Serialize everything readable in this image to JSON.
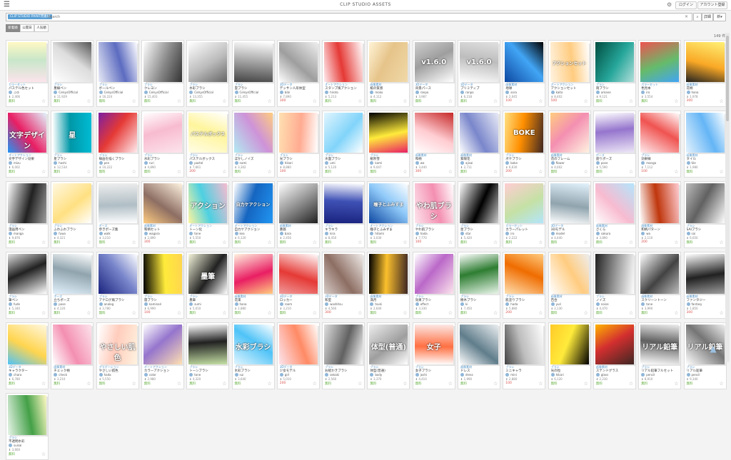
{
  "header": {
    "menu_icon": "hamburger-icon",
    "title": "CLIP STUDIO ASSETS",
    "login_label": "ログイン",
    "register_label": "アカウント登録"
  },
  "search": {
    "chip": "CLIP STUDIO PAINT用素材",
    "placeholder": "Search",
    "clear": "✕",
    "search_label": "検索",
    "detail_label": "詳細",
    "sort_label": "新"
  },
  "tabs": [
    "新着順",
    "公開日",
    "人気順"
  ],
  "result_count": "149 件",
  "colors": {
    "accent": "#5a9fd4",
    "free": "#5fae3a",
    "paid": "#d9534f"
  },
  "cards": [
    {
      "cat": "カラーセット",
      "title": "パステル色セット",
      "author": "ふゆ",
      "dl": "2,406",
      "price": "無料",
      "thumb": [
        "#fce4ec",
        "#c8e6c9",
        "#fff9c4"
      ],
      "ov": ""
    },
    {
      "cat": "ブラシ",
      "title": "墨線ペン",
      "author": "CelsysOfficial",
      "dl": "11,929",
      "price": "無料",
      "thumb": [
        "#ffffff",
        "#dddddd",
        "#555555"
      ],
      "ov": ""
    },
    {
      "cat": "ブラシ",
      "title": "ボールペン",
      "author": "CelsysOfficial",
      "dl": "16,224",
      "price": "無料",
      "thumb": [
        "#e8eaf6",
        "#5c6bc0",
        "#ffffff"
      ],
      "ov": ""
    },
    {
      "cat": "ブラシ",
      "title": "クレヨン",
      "author": "CelsysOfficial",
      "dl": "15,403",
      "price": "無料",
      "thumb": [
        "#ffffff",
        "#888888",
        "#333333"
      ],
      "ov": ""
    },
    {
      "cat": "ブラシ",
      "title": "水彩ブラシ",
      "author": "CelsysOfficial",
      "dl": "13,355",
      "price": "無料",
      "thumb": [
        "#ffffff",
        "#bbbbbb",
        "#666666"
      ],
      "ov": ""
    },
    {
      "cat": "ブラシ",
      "title": "雲ブラシ",
      "author": "CelsysOfficial",
      "dl": "11,455",
      "price": "無料",
      "thumb": [
        "#ffffff",
        "#999999",
        "#444444"
      ],
      "ov": ""
    },
    {
      "cat": "3Dデータ",
      "title": "デッサン人形体型",
      "author": "bibi",
      "dl": "7,890",
      "price": "300",
      "thumb": [
        "#eeeeee",
        "#9e9e9e",
        "#ffffff"
      ],
      "ov": ""
    },
    {
      "cat": "オートアクション",
      "title": "スタンプ風アクション",
      "author": "hiroto",
      "dl": "5,213",
      "price": "無料",
      "thumb": [
        "#ffffff",
        "#e53935",
        "#ffebee"
      ],
      "ov": ""
    },
    {
      "cat": "画像素材",
      "title": "紙の質感",
      "author": "moko",
      "dl": "4,112",
      "price": "無料",
      "thumb": [
        "#f0d9a8",
        "#e6c48a",
        "#fff3d6"
      ],
      "ov": ""
    },
    {
      "cat": "3Dデータ",
      "title": "背景パース",
      "author": "ranpo",
      "dl": "3,987",
      "price": "無料",
      "thumb": [
        "#ffffff",
        "#9e9e9e",
        "#cfcfcf"
      ],
      "ov": "v1.6.0"
    },
    {
      "cat": "3Dデータ",
      "title": "プリミティブ",
      "author": "ranpo",
      "dl": "6,218",
      "price": "無料",
      "thumb": [
        "#ffffff",
        "#bdbdbd",
        "#e0e0e0"
      ],
      "ov": "v1.6.0"
    },
    {
      "cat": "画像素材",
      "title": "地球",
      "author": "sora",
      "dl": "2,045",
      "price": "100",
      "thumb": [
        "#0d47a1",
        "#42a5f5",
        "#000000"
      ],
      "ov": ""
    },
    {
      "cat": "オートアクション",
      "title": "アクションセット",
      "author": "kaito",
      "dl": "8,402",
      "price": "500",
      "thumb": [
        "#fff3e0",
        "#ffcc80",
        "#ffffff"
      ],
      "ov": "アクションセット"
    },
    {
      "cat": "ブラシ",
      "title": "雨ブラシ",
      "author": "amane",
      "dl": "9,121",
      "price": "無料",
      "thumb": [
        "#004d40",
        "#26a69a",
        "#b2dfdb"
      ],
      "ov": ""
    },
    {
      "cat": "カラーセット",
      "title": "色見本",
      "author": "iro",
      "dl": "3,554",
      "price": "無料",
      "thumb": [
        "#ef5350",
        "#66bb6a",
        "#42a5f5"
      ],
      "ov": ""
    },
    {
      "cat": "画像素材",
      "title": "花柄",
      "author": "hana",
      "dl": "1,978",
      "price": "300",
      "thumb": [
        "#fff176",
        "#f9a825",
        "#212121"
      ],
      "ov": ""
    },
    {
      "cat": "オートアクション",
      "title": "文字デザイン効果",
      "author": "mizu",
      "dl": "6,002",
      "price": "無料",
      "thumb": [
        "#e1f5fe",
        "#e91e63",
        "#2196f3"
      ],
      "ov": "文字デザイン"
    },
    {
      "cat": "ブラシ",
      "title": "星ブラシ",
      "author": "hoshi",
      "dl": "12,534",
      "price": "無料",
      "thumb": [
        "#00bcd4",
        "#0097a7",
        "#ffffff"
      ],
      "ov": "星"
    },
    {
      "cat": "ブラシ",
      "title": "線画を描くブラシ",
      "author": "pen",
      "dl": "10,222",
      "price": "無料",
      "thumb": [
        "#ffebee",
        "#e53935",
        "#7b1fa2"
      ],
      "ov": ""
    },
    {
      "cat": "ブラシ",
      "title": "水彩ブラシ",
      "author": "ruri",
      "dl": "4,890",
      "price": "無料",
      "thumb": [
        "#fce4ec",
        "#f8bbd0",
        "#ffffff"
      ],
      "ov": ""
    },
    {
      "cat": "ブラシ",
      "title": "パステルボックス",
      "author": "pastel",
      "dl": "7,661",
      "price": "200",
      "thumb": [
        "#fffde7",
        "#fff59d",
        "#ffffff"
      ],
      "ov": "パステルボックス"
    },
    {
      "cat": "ブラシ",
      "title": "ぼかしノイズ",
      "author": "nami",
      "dl": "3,302",
      "price": "無料",
      "thumb": [
        "#b2ebf2",
        "#ce93d8",
        "#ffcc80"
      ],
      "ov": ""
    },
    {
      "cat": "ブラシ",
      "title": "光ブラシ",
      "author": "hikari",
      "dl": "8,880",
      "price": "100",
      "thumb": [
        "#ffe0b2",
        "#ffab91",
        "#fff"
      ],
      "ov": ""
    },
    {
      "cat": "ブラシ",
      "title": "水面ブラシ",
      "author": "umi",
      "dl": "5,120",
      "price": "無料",
      "thumb": [
        "#e1f5fe",
        "#81d4fa",
        "#ffffff"
      ],
      "ov": ""
    },
    {
      "cat": "ブラシ",
      "title": "紙吹雪",
      "author": "kami",
      "dl": "9,047",
      "price": "無料",
      "thumb": [
        "#000000",
        "#ffeb3b",
        "#e91e63"
      ],
      "ov": ""
    },
    {
      "cat": "画像素材",
      "title": "和柄",
      "author": "wa",
      "dl": "3,440",
      "price": "300",
      "thumb": [
        "#c62828",
        "#ffcdd2",
        "#ffffff"
      ],
      "ov": ""
    },
    {
      "cat": "画像素材",
      "title": "紫陽花",
      "author": "ajisai",
      "dl": "2,711",
      "price": "無料",
      "thumb": [
        "#e8eaf6",
        "#7986cb",
        "#ffffff"
      ],
      "ov": ""
    },
    {
      "cat": "ブラシ",
      "title": "ボケブラシ",
      "author": "boke",
      "dl": "6,630",
      "price": "200",
      "thumb": [
        "#3e2723",
        "#ff8f00",
        "#ffe082"
      ],
      "ov": "BOKE"
    },
    {
      "cat": "画像素材",
      "title": "花のフレーム",
      "author": "flower",
      "dl": "4,002",
      "price": "無料",
      "thumb": [
        "#fff3e0",
        "#f48fb1",
        "#ffcc80"
      ],
      "ov": ""
    },
    {
      "cat": "ポーズ",
      "title": "座りポーズ",
      "author": "pose",
      "dl": "5,590",
      "price": "無料",
      "thumb": [
        "#ede7f6",
        "#9575cd",
        "#ffffff"
      ],
      "ov": ""
    },
    {
      "cat": "ブラシ",
      "title": "効果線",
      "author": "manga",
      "dl": "7,112",
      "price": "100",
      "thumb": [
        "#ffebee",
        "#ef5350",
        "#ffffff"
      ],
      "ov": ""
    },
    {
      "cat": "画像素材",
      "title": "タイル",
      "author": "tile",
      "dl": "1,980",
      "price": "無料",
      "thumb": [
        "#e3f2fd",
        "#64b5f6",
        "#ffffff"
      ],
      "ov": ""
    },
    {
      "cat": "ブラシ",
      "title": "漫画用ペン",
      "author": "manga",
      "dl": "9,876",
      "price": "無料",
      "thumb": [
        "#ffffff",
        "#212121",
        "#9e9e9e"
      ],
      "ov": ""
    },
    {
      "cat": "ブラシ",
      "title": "ふわふわブラシ",
      "author": "fuwa",
      "dl": "4,321",
      "price": "無料",
      "thumb": [
        "#fff8e1",
        "#ffe082",
        "#ffffff"
      ],
      "ov": ""
    },
    {
      "cat": "ポーズ",
      "title": "歩きポーズ集",
      "author": "walk",
      "dl": "3,210",
      "price": "無料",
      "thumb": [
        "#eeeeee",
        "#b0bec5",
        "#ffffff"
      ],
      "ov": ""
    },
    {
      "cat": "画像素材",
      "title": "和柄セット",
      "author": "wagara",
      "dl": "2,890",
      "price": "300",
      "thumb": [
        "#fff3e0",
        "#8d6e63",
        "#ffcc80"
      ],
      "ov": ""
    },
    {
      "cat": "オートアクション",
      "title": "トーン化",
      "author": "tone",
      "dl": "5,550",
      "price": "無料",
      "thumb": [
        "#f8bbd0",
        "#4dd0e1",
        "#fff59d"
      ],
      "ov": "アクション"
    },
    {
      "cat": "オートアクション",
      "title": "自力ケアクション",
      "author": "kea",
      "dl": "6,120",
      "price": "無料",
      "thumb": [
        "#2196f3",
        "#1565c0",
        "#ffffff"
      ],
      "ov": "自力ケアクション"
    },
    {
      "cat": "画像素材",
      "title": "薔薇",
      "author": "bara",
      "dl": "2,456",
      "price": "無料",
      "thumb": [
        "#212121",
        "#9e9e9e",
        "#ffffff"
      ],
      "ov": ""
    },
    {
      "cat": "ブラシ",
      "title": "キラキラ",
      "author": "kira",
      "dl": "8,450",
      "price": "無料",
      "thumb": [
        "#1a237e",
        "#3f51b5",
        "#ffffff"
      ],
      "ov": ""
    },
    {
      "cat": "オートアクション",
      "title": "瞳子とふみすま",
      "author": "hitomi",
      "dl": "3,030",
      "price": "無料",
      "thumb": [
        "#0d47a1",
        "#90caf9",
        "#ffffff"
      ],
      "ov": "瞳子とふみすま"
    },
    {
      "cat": "ブラシ",
      "title": "やわ肌ブラシ",
      "author": "hada",
      "dl": "7,770",
      "price": "100",
      "thumb": [
        "#fce4ec",
        "#f48fb1",
        "#ffffff"
      ],
      "ov": "やわ肌ブラシ"
    },
    {
      "cat": "ブラシ",
      "title": "星ブラシ",
      "author": "star",
      "dl": "5,420",
      "price": "無料",
      "thumb": [
        "#ffffff",
        "#000000",
        "#cccccc"
      ],
      "ov": ""
    },
    {
      "cat": "カラーセット",
      "title": "カラーパレット",
      "author": "iro",
      "dl": "2,222",
      "price": "無料",
      "thumb": [
        "#ffcdd2",
        "#c5e1a5",
        "#b3e5fc"
      ],
      "ov": ""
    },
    {
      "cat": "3Dデータ",
      "title": "3Dモデル",
      "author": "model",
      "dl": "4,440",
      "price": "無料",
      "thumb": [
        "#e3f2fd",
        "#90a4ae",
        "#ffffff"
      ],
      "ov": ""
    },
    {
      "cat": "画像素材",
      "title": "さくら",
      "author": "sakura",
      "dl": "3,890",
      "price": "無料",
      "thumb": [
        "#b3e5fc",
        "#f8bbd0",
        "#ffffff"
      ],
      "ov": ""
    },
    {
      "cat": "画像素材",
      "title": "和柄パターン",
      "author": "wa",
      "dl": "2,110",
      "price": "200",
      "thumb": [
        "#ffcdd2",
        "#bf360c",
        "#ffffff"
      ],
      "ov": ""
    },
    {
      "cat": "ブラシ",
      "title": "SAIブラシ",
      "author": "sai",
      "dl": "6,650",
      "price": "無料",
      "thumb": [
        "#ffffff",
        "#616161",
        "#bdbdbd"
      ],
      "ov": ""
    },
    {
      "cat": "ブラシ",
      "title": "筆ペン",
      "author": "fude",
      "dl": "5,340",
      "price": "無料",
      "thumb": [
        "#ffffff",
        "#212121",
        "#e0e0e0"
      ],
      "ov": ""
    },
    {
      "cat": "ポーズ",
      "title": "立ちポーズ",
      "author": "pose",
      "dl": "4,120",
      "price": "無料",
      "thumb": [
        "#e3f2fd",
        "#90a4ae",
        "#ffffff"
      ],
      "ov": ""
    },
    {
      "cat": "ブラシ",
      "title": "アナログ風ブラシ",
      "author": "analog",
      "dl": "3,780",
      "price": "無料",
      "thumb": [
        "#1a237e",
        "#7986cb",
        "#ffffff"
      ],
      "ov": ""
    },
    {
      "cat": "ブラシ",
      "title": "雷ブラシ",
      "author": "kaminari",
      "dl": "6,990",
      "price": "100",
      "thumb": [
        "#000000",
        "#ffeb3b",
        "#ffd54f"
      ],
      "ov": ""
    },
    {
      "cat": "ブラシ",
      "title": "墨筆",
      "author": "sumi",
      "dl": "5,010",
      "price": "無料",
      "thumb": [
        "#f5f5dc",
        "#212121",
        "#ffffff"
      ],
      "ov": "墨筆"
    },
    {
      "cat": "画像素材",
      "title": "花束",
      "author": "hana",
      "dl": "2,880",
      "price": "無料",
      "thumb": [
        "#fff3e0",
        "#e91e63",
        "#ffcc80"
      ],
      "ov": ""
    },
    {
      "cat": "3Dデータ",
      "title": "ロッカー",
      "author": "room",
      "dl": "3,210",
      "price": "無料",
      "thumb": [
        "#ffffff",
        "#e53935",
        "#ef9a9a"
      ],
      "ov": ""
    },
    {
      "cat": "3Dデータ",
      "title": "和室",
      "author": "washitsu",
      "dl": "4,560",
      "price": "300",
      "thumb": [
        "#efebe9",
        "#8d6e63",
        "#d7ccc8"
      ],
      "ov": ""
    },
    {
      "cat": "画像素材",
      "title": "満月",
      "author": "tsuki",
      "dl": "2,640",
      "price": "無料",
      "thumb": [
        "#3e2723",
        "#fbc02d",
        "#000000"
      ],
      "ov": ""
    },
    {
      "cat": "ブラシ",
      "title": "効果ブラシ",
      "author": "effect",
      "dl": "3,330",
      "price": "無料",
      "thumb": [
        "#fce4ec",
        "#ba68c8",
        "#ffffff"
      ],
      "ov": ""
    },
    {
      "cat": "ブラシ",
      "title": "樹木ブラシ",
      "author": "ki",
      "dl": "7,450",
      "price": "無料",
      "thumb": [
        "#e8f5e9",
        "#2e7d32",
        "#ffffff"
      ],
      "ov": ""
    },
    {
      "cat": "ブラシ",
      "title": "肌塗りブラシ",
      "author": "hada",
      "dl": "5,880",
      "price": "200",
      "thumb": [
        "#ffe0b2",
        "#ef6c00",
        "#ffcc80"
      ],
      "ov": ""
    },
    {
      "cat": "画像素材",
      "title": "百合",
      "author": "yuri",
      "dl": "2,130",
      "price": "無料",
      "thumb": [
        "#ffffff",
        "#ffcc80",
        "#eeeeee"
      ],
      "ov": ""
    },
    {
      "cat": "ブラシ",
      "title": "ノイズ",
      "author": "noise",
      "dl": "4,470",
      "price": "無料",
      "thumb": [
        "#212121",
        "#9e9e9e",
        "#ffffff"
      ],
      "ov": ""
    },
    {
      "cat": "画像素材",
      "title": "スクリーントーン",
      "author": "tone",
      "dl": "3,990",
      "price": "無料",
      "thumb": [
        "#ffffff",
        "#424242",
        "#bdbdbd"
      ],
      "ov": ""
    },
    {
      "cat": "画像素材",
      "title": "ファンタジー",
      "author": "fantasy",
      "dl": "1,850",
      "price": "300",
      "thumb": [
        "#ffffff",
        "#212121",
        "#9e9e9e"
      ],
      "ov": ""
    },
    {
      "cat": "3Dデータ",
      "title": "キャラクター",
      "author": "chara",
      "dl": "6,780",
      "price": "無料",
      "thumb": [
        "#fff8e1",
        "#ffd54f",
        "#4fc3f7"
      ],
      "ov": ""
    },
    {
      "cat": "画像素材",
      "title": "チェック柄",
      "author": "check",
      "dl": "3,210",
      "price": "無料",
      "thumb": [
        "#fce4ec",
        "#f48fb1",
        "#ffffff"
      ],
      "ov": ""
    },
    {
      "cat": "グラデーション",
      "title": "やさしい肌色",
      "author": "hada",
      "dl": "5,550",
      "price": "無料",
      "thumb": [
        "#fff3e0",
        "#ffccbc",
        "#ffffff"
      ],
      "ov": "やさしい肌色"
    },
    {
      "cat": "オートアクション",
      "title": "カラーアクション",
      "author": "color",
      "dl": "2,980",
      "price": "無料",
      "thumb": [
        "#ffe0b2",
        "#9575cd",
        "#ffffff"
      ],
      "ov": ""
    },
    {
      "cat": "ブラシ",
      "title": "トーンブラシ",
      "author": "tone",
      "dl": "4,320",
      "price": "無料",
      "thumb": [
        "#c5e1a5",
        "#212121",
        "#ffffff"
      ],
      "ov": ""
    },
    {
      "cat": "ブラシ",
      "title": "水彩ブラシ",
      "author": "sui",
      "dl": "3,640",
      "price": "無料",
      "thumb": [
        "#e1f5fe",
        "#4fc3f7",
        "#ffffff"
      ],
      "ov": "水彩ブラシ"
    },
    {
      "cat": "3Dデータ",
      "title": "少女モデル",
      "author": "girl",
      "dl": "5,010",
      "price": "200",
      "thumb": [
        "#fce4ec",
        "#ff8a65",
        "#ffffff"
      ],
      "ov": ""
    },
    {
      "cat": "ブラシ",
      "title": "お絵かきブラシ",
      "author": "oekaki",
      "dl": "2,560",
      "price": "無料",
      "thumb": [
        "#e0e0e0",
        "#616161",
        "#ffffff"
      ],
      "ov": ""
    },
    {
      "cat": "ブラシ",
      "title": "体型(普通)",
      "author": "body",
      "dl": "3,370",
      "price": "無料",
      "thumb": [
        "#eeeeee",
        "#9e9e9e",
        "#ffffff"
      ],
      "ov": "体型(普通)"
    },
    {
      "cat": "ブラシ",
      "title": "女子ブラシ",
      "author": "joshi",
      "dl": "4,410",
      "price": "無料",
      "thumb": [
        "#fbe9e7",
        "#ff7043",
        "#ffffff"
      ],
      "ov": "女子"
    },
    {
      "cat": "画像素材",
      "title": "ドレス",
      "author": "dress",
      "dl": "1,990",
      "price": "無料",
      "thumb": [
        "#eceff1",
        "#607d8b",
        "#ffffff"
      ],
      "ov": ""
    },
    {
      "cat": "ブラシ",
      "title": "ミニキャラ",
      "author": "mini",
      "dl": "2,880",
      "price": "100",
      "thumb": [
        "#ffffff",
        "#bdbdbd",
        "#424242"
      ],
      "ov": ""
    },
    {
      "cat": "ブラシ",
      "title": "光の粒",
      "author": "hikari",
      "dl": "6,120",
      "price": "無料",
      "thumb": [
        "#000000",
        "#ffeb3b",
        "#ffca28"
      ],
      "ov": ""
    },
    {
      "cat": "画像素材",
      "title": "ステンドグラス",
      "author": "glass",
      "dl": "2,230",
      "price": "無料",
      "thumb": [
        "#3e2723",
        "#d32f2f",
        "#ffb300"
      ],
      "ov": ""
    },
    {
      "cat": "ブラシ",
      "title": "リアル鉛筆フルセット",
      "author": "pencil",
      "dl": "8,910",
      "price": "無料",
      "thumb": [
        "#ffffff",
        "#616161",
        "#eeeeee"
      ],
      "ov": "リアル鉛筆"
    },
    {
      "cat": "ブラシ",
      "title": "リアル鉛筆",
      "author": "pencil",
      "dl": "9,340",
      "price": "無料",
      "thumb": [
        "#ffffff",
        "#757575",
        "#eeeeee"
      ],
      "ov": "リアル鉛筆"
    },
    {
      "cat": "ブラシ",
      "title": "不透明水彩",
      "author": "suisai",
      "dl": "3,660",
      "price": "無料",
      "thumb": [
        "#e8f5e9",
        "#43a047",
        "#fff9c4"
      ],
      "ov": ""
    }
  ]
}
